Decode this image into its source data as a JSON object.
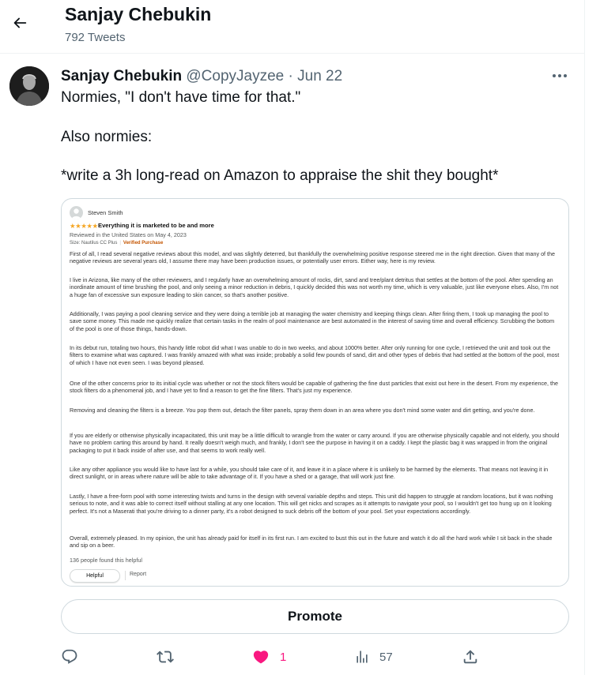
{
  "header": {
    "title": "Sanjay Chebukin",
    "subtitle": "792 Tweets"
  },
  "tweet": {
    "author_name": "Sanjay Chebukin",
    "author_handle": "@CopyJayzee",
    "separator": "·",
    "date": "Jun 22",
    "text_lines": [
      "Normies, \"I don't have time for that.\"",
      "Also normies:",
      "*write a 3h long-read on Amazon to appraise the shit they bought*"
    ]
  },
  "review": {
    "reviewer": "Steven Smith",
    "stars": "★★★★★",
    "title": "Everything it is marketed to be and more",
    "meta": "Reviewed in the United States on May 4, 2023",
    "variant": "Size: Nautilus CC Plus",
    "verified": "Verified Purchase",
    "paragraphs": [
      "First of all, I read several negative reviews about this model, and was slightly deterred, but thankfully the overwhelming positive response steered me in the right direction. Given that many of the negative reviews are several years old, I assume there may have been production issues, or potentially user errors. Either way, here is my review.",
      "I live in Arizona, like many of the other reviewers, and I regularly have an overwhelming amount of rocks, dirt, sand and tree/plant detritus that settles at the bottom of the pool. After spending an inordinate amount of time brushing the pool, and only seeing a minor reduction in debris, I quickly decided this was not worth my time, which is very valuable, just like everyone elses. Also, I'm not a huge fan of excessive sun exposure leading to skin cancer, so that's another positive.",
      "Additionally, I was paying a pool cleaning service and they were doing a terrible job at managing the water chemistry and keeping things clean. After firing them, I took up managing the pool to save some money. This made me quickly realize that certain tasks in the realm of pool maintenance are best automated in the interest of saving time and overall efficiency. Scrubbing the bottom of the pool is one of those things, hands-down.",
      "In its debut run, totaling two hours, this handy little robot did what I was unable to do in two weeks, and about 1000% better. After only running for one cycle, I retrieved the unit and took out the filters to examine what was captured. I was frankly amazed with what was inside; probably a solid few pounds of sand, dirt and other types of debris that had settled at the bottom of the pool, most of which I have not even seen. I was beyond pleased.",
      "One of the other concerns prior to its initial cycle was whether or not the stock filters would be capable of gathering the fine dust particles that exist out here in the desert. From my experience, the stock filters do a phenomenal job, and I have yet to find a reason to get the fine filters. That's just my experience.",
      "Removing and cleaning the filters is a breeze. You pop them out, detach the filter panels, spray them down in an area where you don't mind some water and dirt getting, and you're done.",
      "If you are elderly or otherwise physically incapacitated, this unit may be a little difficult to wrangle from the water or carry around. If you are otherwise physically capable and not elderly, you should have no problem carting this around by hand. It really doesn't weigh much, and frankly, I don't see the purpose in having it on a caddy. I kept the plastic bag it was wrapped in from the original packaging to put it back inside of after use, and that seems to work really well.",
      "Like any other appliance you would like to have last for a while, you should take care of it, and leave it in a place where it is unlikely to be harmed by the elements. That means not leaving it in direct sunlight, or in areas where nature will be able to take advantage of it. If you have a shed or a garage, that will work just fine.",
      "Lastly, I have a free-form pool with some interesting twists and turns in the design with several variable depths and steps. This unit did happen to struggle at random locations, but it was nothing serious to note, and it was able to correct itself without stalling at any one location. This will get nicks and scrapes as it attempts to navigate your pool, so I wouldn't get too hung up on it looking perfect. It's not a Maserati that you're driving to a dinner party, it's a robot designed to suck debris off the bottom of your pool. Set your expectations accordingly.",
      "Overall, extremely pleased. In my opinion, the unit has already paid for itself in its first run. I am excited to bust this out in the future and watch it do all the hard work while I sit back in the shade and sip on a beer."
    ],
    "helpful_count": "136 people found this helpful",
    "helpful_button": "Helpful",
    "report": "Report"
  },
  "promote_label": "Promote",
  "actions": {
    "likes": "1",
    "views": "57"
  },
  "colors": {
    "like_pink": "#f91880",
    "star_orange": "#f5a623",
    "verified_orange": "#c45500",
    "secondary_text": "#536471"
  }
}
